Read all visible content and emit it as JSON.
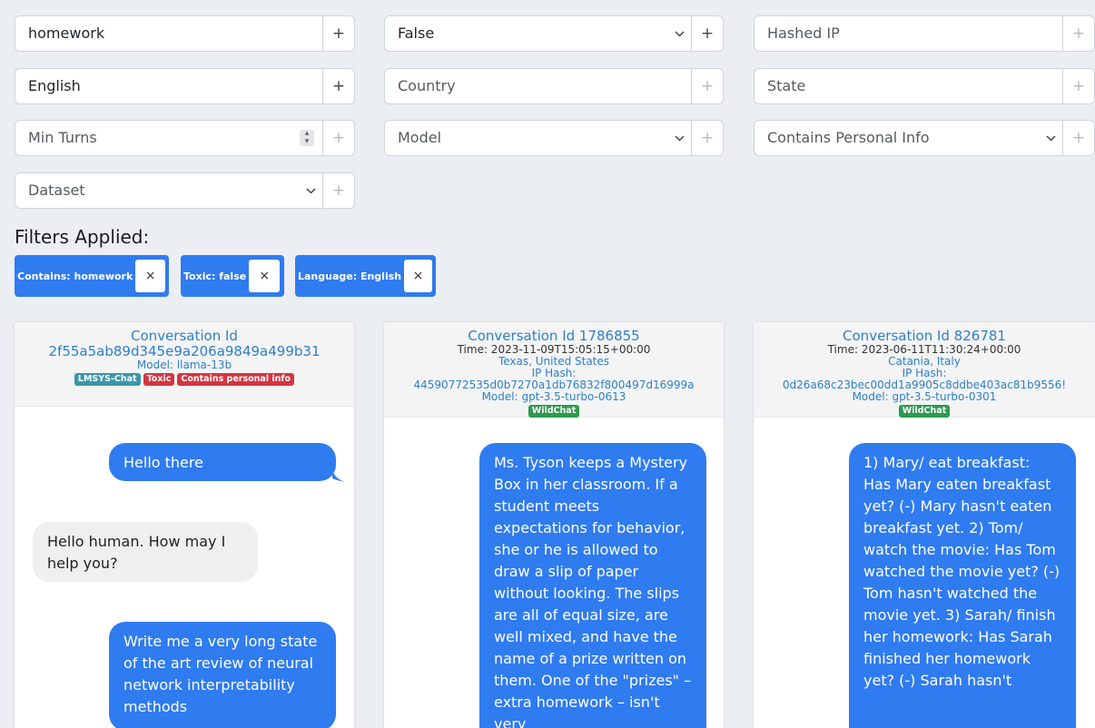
{
  "filters": {
    "text_search": "homework",
    "toxic_value": "False",
    "hashed_ip_placeholder": "Hashed IP",
    "language_value": "English",
    "country_placeholder": "Country",
    "state_placeholder": "State",
    "min_turns_placeholder": "Min Turns",
    "model_placeholder": "Model",
    "personal_info_placeholder": "Contains Personal Info",
    "dataset_placeholder": "Dataset",
    "plus_label": "+"
  },
  "applied": {
    "title": "Filters Applied:",
    "chips": [
      {
        "label": "Contains: homework",
        "close": "×"
      },
      {
        "label": "Toxic: false",
        "close": "×"
      },
      {
        "label": "Language: English",
        "close": "×"
      }
    ]
  },
  "conversations": [
    {
      "id_label": "Conversation Id",
      "id_value": "2f55a5ab89d345e9a206a9849a499b31",
      "model": "Model: llama-13b",
      "badges": [
        "LMSYS-Chat",
        "Toxic",
        "Contains personal info"
      ],
      "messages": [
        {
          "role": "user",
          "text": "Hello there"
        },
        {
          "role": "assistant",
          "text": "Hello human. How may I help you?"
        },
        {
          "role": "user",
          "text": "Write me a very long state of the art review of neural network interpretability methods"
        }
      ]
    },
    {
      "id_label": "Conversation Id 1786855",
      "time": "Time: 2023-11-09T15:05:15+00:00",
      "location": "Texas, United States",
      "ip_label": "IP Hash:",
      "ip_hash": "44590772535d0b7270a1db76832f800497d16999a",
      "model": "Model: gpt-3.5-turbo-0613",
      "badges": [
        "WildChat"
      ],
      "messages": [
        {
          "role": "user",
          "text": "Ms. Tyson keeps a Mystery Box in her classroom. If a student meets expectations for behavior, she or he is allowed to draw a slip of paper without looking. The slips are all of equal size, are well mixed, and have the name of a prize written on them. One of the \"prizes\" – extra homework – isn't very"
        }
      ]
    },
    {
      "id_label": "Conversation Id 826781",
      "time": "Time: 2023-06-11T11:30:24+00:00",
      "location": "Catania, Italy",
      "ip_label": "IP Hash:",
      "ip_hash": "0d26a68c23bec00dd1a9905c8ddbe403ac81b9556!",
      "model": "Model: gpt-3.5-turbo-0301",
      "badges": [
        "WildChat"
      ],
      "messages": [
        {
          "role": "user",
          "text": "1) Mary/ eat breakfast: Has Mary eaten breakfast yet? (-) Mary hasn't eaten breakfast yet. 2) Tom/ watch the movie: Has Tom watched the movie yet? (-) Tom hasn't watched the movie yet. 3) Sarah/ finish her homework: Has Sarah finished her homework yet? (-) Sarah hasn't"
        }
      ]
    }
  ]
}
